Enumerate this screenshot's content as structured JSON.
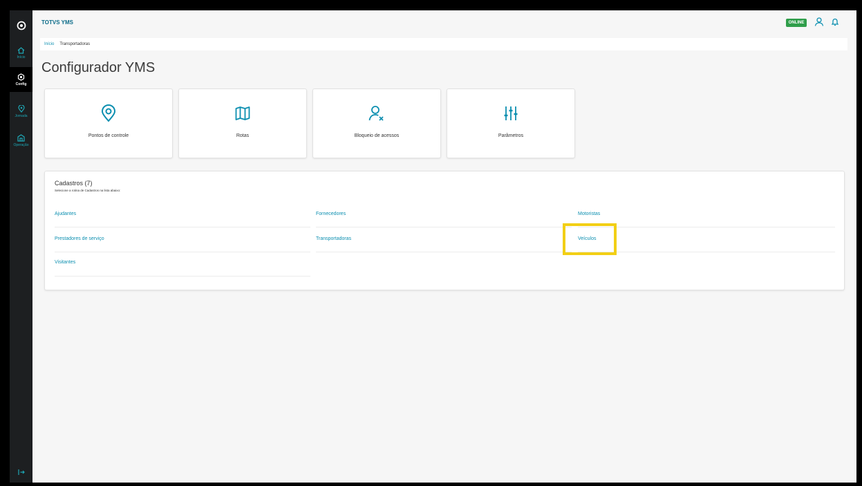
{
  "app": {
    "title": "TOTVS YMS",
    "status_badge": "ONLINE"
  },
  "sidebar": {
    "items": [
      {
        "label": "Início",
        "icon": "home-icon"
      },
      {
        "label": "Config",
        "icon": "gear-icon"
      },
      {
        "label": "Jornada",
        "icon": "location-pin-icon"
      },
      {
        "label": "Operação",
        "icon": "building-icon"
      }
    ]
  },
  "breadcrumb": {
    "home": "Início",
    "current": "Transportadoras"
  },
  "page": {
    "title": "Configurador YMS"
  },
  "cards": [
    {
      "label": "Pontos de controle",
      "icon": "location-pin-icon"
    },
    {
      "label": "Rotas",
      "icon": "map-icon"
    },
    {
      "label": "Bloqueio de acessos",
      "icon": "user-blocked-icon"
    },
    {
      "label": "Parâmetros",
      "icon": "sliders-icon"
    }
  ],
  "cadastros": {
    "title": "Cadastros (7)",
    "subtitle": "Selecione a rotina de Cadastros na lista abaixo:",
    "items": [
      "Ajudantes",
      "Fornecedores",
      "Motoristas",
      "Prestadores de serviço",
      "Transportadoras",
      "Veículos",
      "Visitantes"
    ]
  },
  "colors": {
    "accent": "#0c8fb0",
    "sidebar": "#1d1f21",
    "online": "#2f9e4a",
    "highlight": "#f2cf15"
  }
}
